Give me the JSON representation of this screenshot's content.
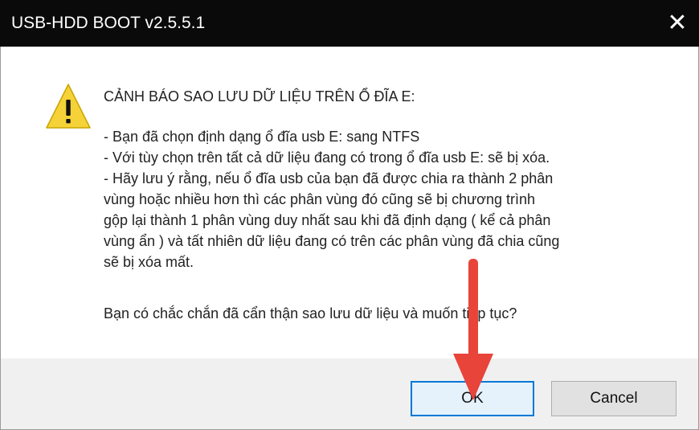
{
  "window": {
    "title": "USB-HDD BOOT v2.5.5.1",
    "close_glyph": "✕"
  },
  "dialog": {
    "icon": "warning-triangle-icon",
    "heading": "CẢNH BÁO SAO LƯU DỮ LIỆU TRÊN Ổ ĐĨA E:",
    "lines": [
      " - Bạn đã chọn định dạng ổ đĩa usb E: sang NTFS",
      " - Với tùy chọn trên tất cả dữ liệu đang có trong ổ đĩa usb E: sẽ bị xóa.",
      " - Hãy lưu ý rằng, nếu ổ đĩa usb của bạn đã được chia ra thành 2 phân",
      "vùng hoặc nhiều hơn thì các phân vùng đó cũng sẽ bị chương trình",
      "gộp lại thành 1 phân vùng duy nhất sau khi đã định dạng ( kể cả phân",
      "vùng ẩn ) và tất nhiên dữ liệu đang có trên các phân vùng đã chia cũng",
      "sẽ bị xóa mất."
    ],
    "question": "Bạn có chắc chắn đã cẩn thận sao lưu dữ liệu và muốn tiếp tục?"
  },
  "buttons": {
    "ok": "OK",
    "cancel": "Cancel"
  },
  "colors": {
    "titlebar": "#0a0a0a",
    "warning_fill": "#f5d237",
    "arrow": "#e8443a",
    "focus_border": "#0078d7"
  }
}
